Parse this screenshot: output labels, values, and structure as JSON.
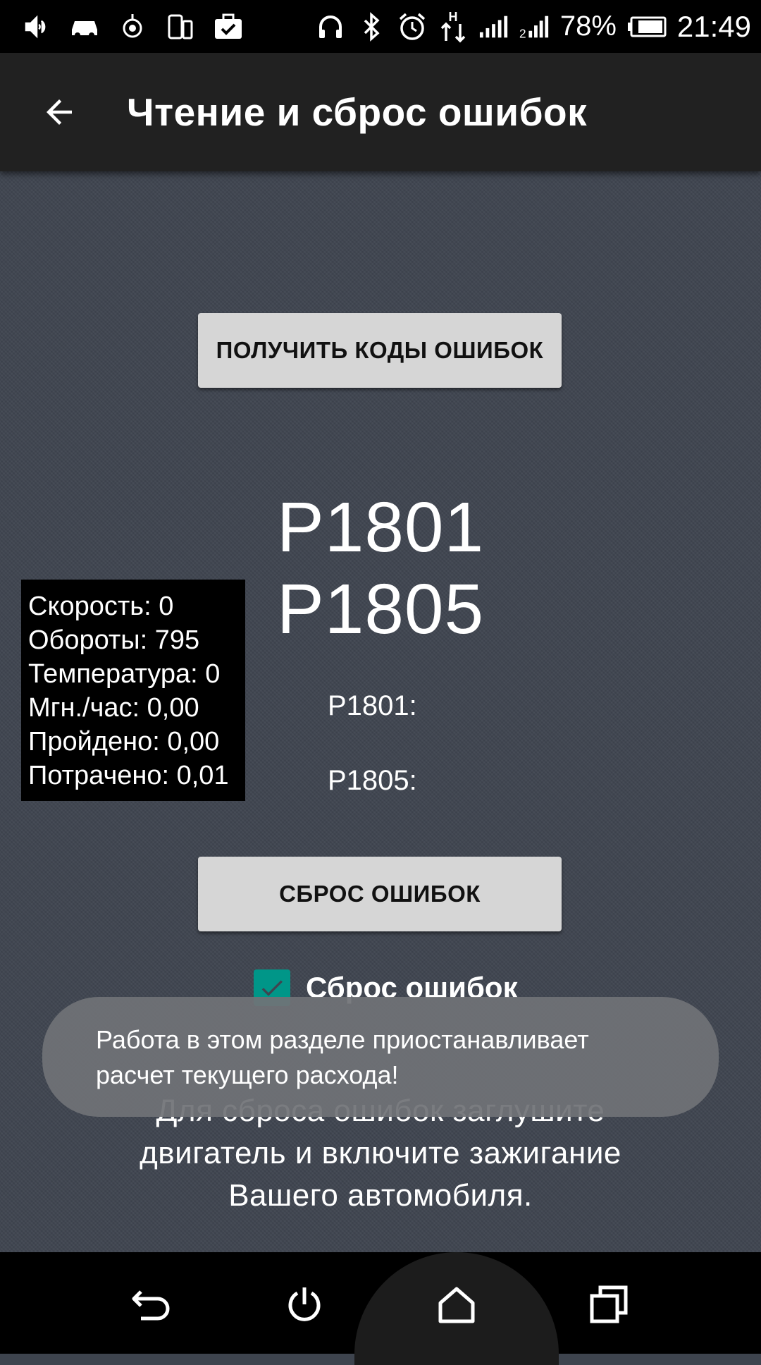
{
  "status_bar": {
    "icons": [
      "volume-icon",
      "car-icon",
      "location-icon",
      "screen-rotate-icon",
      "briefcase-check-icon",
      "headphones-icon",
      "bluetooth-icon",
      "alarm-icon",
      "data-transfer-icon",
      "signal-1-icon",
      "signal-2-icon",
      "battery-icon"
    ],
    "network_type": "H",
    "battery": "78%",
    "time": "21:49"
  },
  "app_bar": {
    "title": "Чтение и сброс ошибок"
  },
  "main": {
    "get_codes_button": "ПОЛУЧИТЬ КОДЫ ОШИБОК",
    "codes": [
      "P1801",
      "P1805"
    ],
    "code_details": [
      "P1801:",
      "P1805:"
    ],
    "reset_button": "СБРОС ОШИБОК",
    "reset_checkbox": {
      "label": "Сброс ошибок",
      "checked": true
    },
    "instruction_lines": [
      "Для сброса ошибок заглушите",
      "двигатель и включите зажигание",
      "Вашего автомобиля."
    ]
  },
  "stats": {
    "speed": "Скорость: 0",
    "rpm": "Обороты: 795",
    "temperature": "Температура: 0",
    "instant_per_hour": "Мгн./час: 0,00",
    "distance": "Пройдено: 0,00",
    "spent": "Потрачено: 0,01"
  },
  "toast": {
    "line1": "Работа в этом разделе приостанавливает",
    "line2": "расчет текущего расхода!"
  },
  "colors": {
    "accent": "#009688",
    "button_bg": "#d6d6d6",
    "app_bar": "#212121",
    "background": "#3f4550"
  },
  "nav_bar": [
    "back-icon",
    "power-icon",
    "home-icon",
    "recents-icon"
  ]
}
